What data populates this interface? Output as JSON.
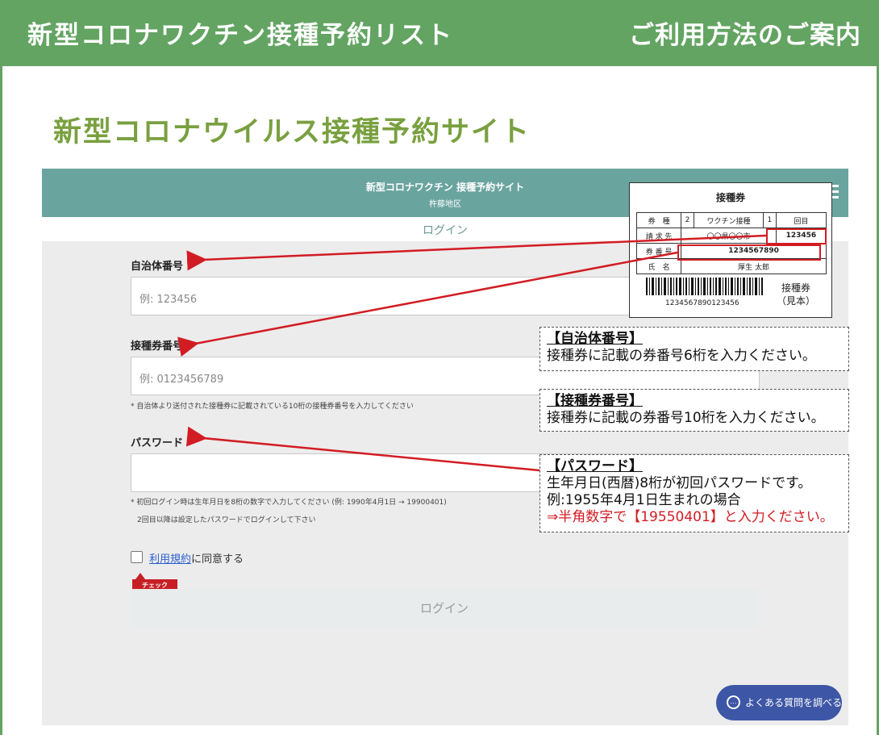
{
  "header": {
    "title": "新型コロナワクチン接種予約リスト",
    "guide": "ご利用方法のご案内"
  },
  "page_heading": "新型コロナウイルス接種予約サイト",
  "site": {
    "title": "新型コロナワクチン 接種予約サイト",
    "subtitle": "杵藤地区",
    "login_tab": "ログイン",
    "fields": {
      "municipality_label": "自治体番号",
      "municipality_placeholder": "例: 123456",
      "ticket_label": "接種券番号",
      "ticket_placeholder": "例: 0123456789",
      "ticket_note": "* 自治体より送付された接種券に記載されている10桁の接種券番号を入力してください",
      "password_label": "パスワード",
      "password_note1": "* 初回ログイン時は生年月日を8桁の数字で入力してください (例: 1990年4月1日 → 19900401)",
      "password_note2": "2回目以降は設定したパスワードでログインして下さい"
    },
    "agree_link": "利用規約",
    "agree_suffix": "に同意する",
    "check_tag": "チェック",
    "login_button": "ログイン",
    "faq_button": "よくある質問を調べる"
  },
  "ticket": {
    "title": "接種券",
    "row1": [
      "券　種",
      "2",
      "ワクチン接種",
      "1",
      "回目"
    ],
    "row2_label": "請 求 先",
    "row2_value": "〇〇県〇〇市",
    "row2_number": "123456",
    "row3_label": "券 番 号",
    "row3_value": "1234567890",
    "row4_label": "氏　名",
    "row4_value": "厚生 太郎",
    "barcode_number": "1234567890123456",
    "sample_line1": "接種券",
    "sample_line2": "（見本）"
  },
  "callouts": [
    {
      "title": "【自治体番号】",
      "lines": [
        "接種券に記載の券番号6桁を入力ください。"
      ]
    },
    {
      "title": "【接種券番号】",
      "lines": [
        "接種券に記載の券番号10桁を入力ください。"
      ]
    },
    {
      "title": "【パスワード】",
      "lines": [
        "生年月日(西暦)8桁が初回パスワードです。",
        "例:1955年4月1日生まれの場合"
      ],
      "red_line": "⇒半角数字で【19550401】と入力ください。"
    }
  ],
  "colors": {
    "header_green": "#63a462",
    "heading_green": "#79a03f",
    "site_header_teal": "#6aa49f",
    "arrow_red": "#d21c23",
    "faq_blue": "#3d56a6"
  }
}
